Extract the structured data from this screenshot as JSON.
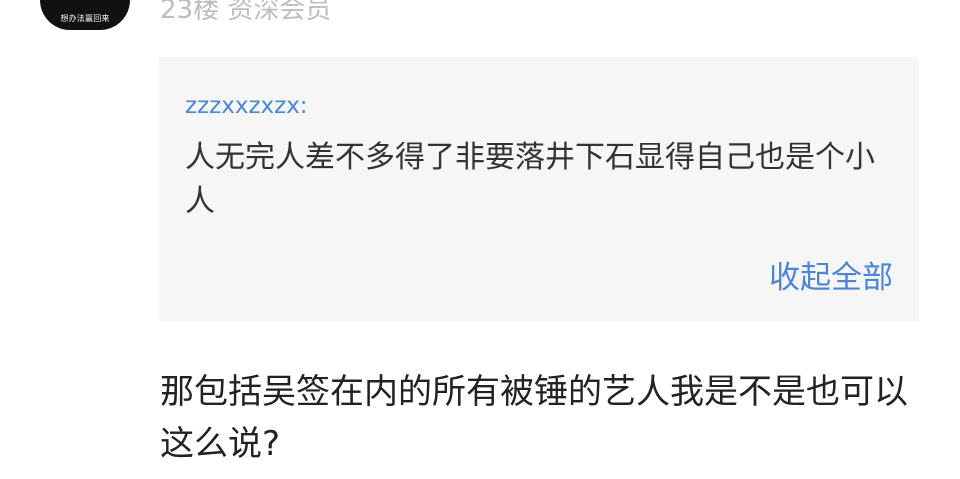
{
  "avatar": {
    "caption": "想办法赢回来"
  },
  "post": {
    "floor_meta": "23楼 资深会员",
    "quote": {
      "user": "zzzxxzxzx:",
      "text": "人无完人差不多得了非要落井下石显得自己也是个小人",
      "collapse_label": "收起全部"
    },
    "reply": "那包括吴签在内的所有被锤的艺人我是不是也可以这么说?"
  },
  "colors": {
    "link": "#4a86d8",
    "quote_bg": "#f6f6f6",
    "meta": "#bdbdbd"
  }
}
